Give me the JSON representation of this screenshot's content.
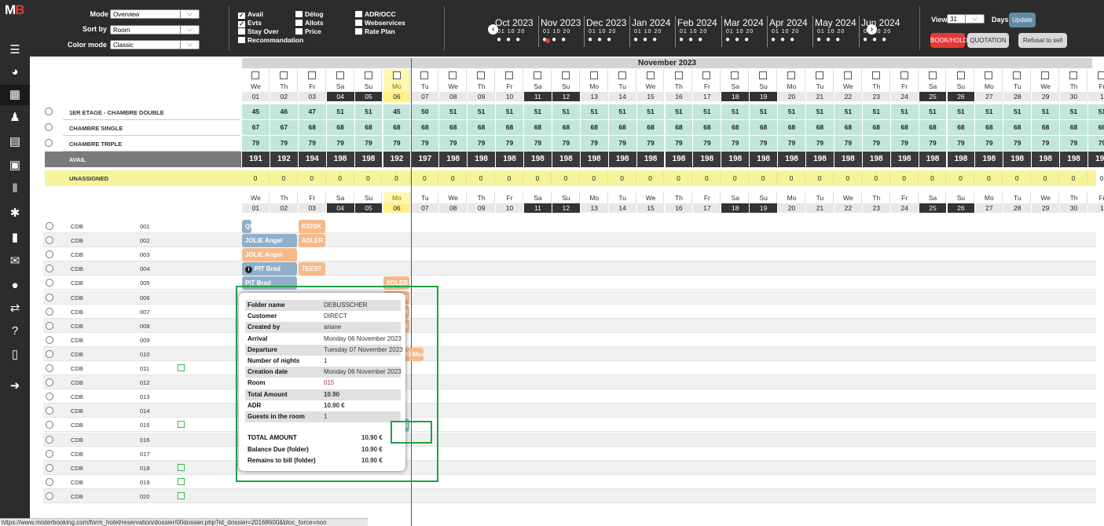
{
  "logo": "MB",
  "sidebar": {
    "icons": [
      "menu-icon",
      "dashboard-icon",
      "calendar-icon",
      "bell-icon",
      "document-icon",
      "calculator-icon",
      "chart-icon",
      "gear-icon",
      "briefcase-icon",
      "mail-icon",
      "user-icon",
      "transfer-icon",
      "help-icon",
      "mobile-icon",
      "logout-icon"
    ]
  },
  "topbar": {
    "mode_label": "Mode",
    "mode_value": "Overview",
    "sort_label": "Sort by",
    "sort_value": "Room",
    "color_label": "Color mode",
    "color_value": "Classic",
    "checks": [
      {
        "label": "Avail",
        "checked": true
      },
      {
        "label": "Evts",
        "checked": true
      },
      {
        "label": "Stay Over",
        "checked": false
      },
      {
        "label": "Recommandation",
        "checked": false
      },
      {
        "label": "Délog",
        "checked": false
      },
      {
        "label": "Allots",
        "checked": false
      },
      {
        "label": "Price",
        "checked": false
      },
      {
        "label": "ADR/OCC",
        "checked": false
      },
      {
        "label": "Webservices",
        "checked": false
      },
      {
        "label": "Rate Plan",
        "checked": false
      }
    ],
    "months": [
      "Oct 2023",
      "Nov 2023",
      "Dec 2023",
      "Jan 2024",
      "Feb 2024",
      "Mar 2024",
      "Apr 2024",
      "May 2024",
      "Jun 2024"
    ],
    "month_days": "01 10 20",
    "view_label": "View",
    "view_value": "31",
    "days_label": "Days",
    "update_label": "Update",
    "book_label": "BOOK/HOLD",
    "quotation_label": "QUOTATION",
    "refusal_label": "Refusal to sell"
  },
  "month_title": "November 2023",
  "days": {
    "dow": [
      "We",
      "Th",
      "Fr",
      "Sa",
      "Su",
      "Mo",
      "Tu",
      "We",
      "Th",
      "Fr",
      "Sa",
      "Su",
      "Mo",
      "Tu",
      "We",
      "Th",
      "Fr",
      "Sa",
      "Su",
      "Mo",
      "Tu",
      "We",
      "Th",
      "Fr",
      "Sa",
      "Su",
      "Mo",
      "Tu",
      "We",
      "Th",
      "Fr"
    ],
    "num": [
      "01",
      "02",
      "03",
      "04",
      "05",
      "06",
      "07",
      "08",
      "09",
      "10",
      "11",
      "12",
      "13",
      "14",
      "15",
      "16",
      "17",
      "18",
      "19",
      "20",
      "21",
      "22",
      "23",
      "24",
      "25",
      "26",
      "27",
      "28",
      "29",
      "30",
      "1"
    ]
  },
  "room_types": [
    {
      "name": "1ER ETAGE - CHAMBRE DOUBLE",
      "values": [
        "45",
        "46",
        "47",
        "51",
        "51",
        "45",
        "50",
        "51",
        "51",
        "51",
        "51",
        "51",
        "51",
        "51",
        "51",
        "51",
        "51",
        "51",
        "51",
        "51",
        "51",
        "51",
        "51",
        "51",
        "51",
        "51",
        "51",
        "51",
        "51",
        "51",
        "51"
      ]
    },
    {
      "name": "CHAMBRE SINGLE",
      "values": [
        "67",
        "67",
        "68",
        "68",
        "68",
        "68",
        "68",
        "68",
        "68",
        "68",
        "68",
        "68",
        "68",
        "68",
        "68",
        "68",
        "68",
        "68",
        "68",
        "68",
        "68",
        "68",
        "68",
        "68",
        "68",
        "68",
        "68",
        "68",
        "68",
        "68",
        "68"
      ]
    },
    {
      "name": "CHAMBRE TRIPLE",
      "values": [
        "79",
        "79",
        "79",
        "79",
        "79",
        "79",
        "79",
        "79",
        "79",
        "79",
        "79",
        "79",
        "79",
        "79",
        "79",
        "79",
        "79",
        "79",
        "79",
        "79",
        "79",
        "79",
        "79",
        "79",
        "79",
        "79",
        "79",
        "79",
        "79",
        "79",
        "79"
      ]
    }
  ],
  "avail": {
    "label": "AVAIL",
    "values": [
      "191",
      "192",
      "194",
      "198",
      "198",
      "192",
      "197",
      "198",
      "198",
      "198",
      "198",
      "198",
      "198",
      "198",
      "198",
      "198",
      "198",
      "198",
      "198",
      "198",
      "198",
      "198",
      "198",
      "198",
      "198",
      "198",
      "198",
      "198",
      "198",
      "198",
      "198"
    ]
  },
  "unassigned": {
    "label": "UNASSIGNED",
    "values": [
      "0",
      "0",
      "0",
      "0",
      "0",
      "0",
      "0",
      "0",
      "0",
      "0",
      "0",
      "0",
      "0",
      "0",
      "0",
      "0",
      "0",
      "0",
      "0",
      "0",
      "0",
      "0",
      "0",
      "0",
      "0",
      "0",
      "0",
      "0",
      "0",
      "0",
      "0"
    ]
  },
  "rooms": [
    {
      "type": "CDB",
      "num": "001",
      "flag": false
    },
    {
      "type": "CDB",
      "num": "002",
      "flag": false
    },
    {
      "type": "CDB",
      "num": "003",
      "flag": false
    },
    {
      "type": "CDB",
      "num": "004",
      "flag": false
    },
    {
      "type": "CDB",
      "num": "005",
      "flag": false
    },
    {
      "type": "CDB",
      "num": "006",
      "flag": false
    },
    {
      "type": "CDB",
      "num": "007",
      "flag": false
    },
    {
      "type": "CDB",
      "num": "008",
      "flag": false
    },
    {
      "type": "CDB",
      "num": "009",
      "flag": false
    },
    {
      "type": "CDB",
      "num": "010",
      "flag": false
    },
    {
      "type": "CDB",
      "num": "011",
      "flag": true
    },
    {
      "type": "CDB",
      "num": "012",
      "flag": false
    },
    {
      "type": "CDB",
      "num": "013",
      "flag": false
    },
    {
      "type": "CDB",
      "num": "014",
      "flag": false
    },
    {
      "type": "CDB",
      "num": "015",
      "flag": true
    },
    {
      "type": "CDB",
      "num": "016",
      "flag": false
    },
    {
      "type": "CDB",
      "num": "017",
      "flag": false
    },
    {
      "type": "CDB",
      "num": "018",
      "flag": true
    },
    {
      "type": "CDB",
      "num": "019",
      "flag": true
    },
    {
      "type": "CDB",
      "num": "020",
      "flag": true
    }
  ],
  "reservations": [
    {
      "label": "QUI",
      "room": 0,
      "start": 0,
      "span": 0.4,
      "color": "#8fb0c8"
    },
    {
      "label": "KIOSK",
      "room": 0,
      "start": 2,
      "span": 1,
      "color": "#f5b98a"
    },
    {
      "label": "JOLIE Angel",
      "room": 1,
      "start": 0,
      "span": 2,
      "color": "#8fb0c8"
    },
    {
      "label": "ADLER",
      "room": 1,
      "start": 2,
      "span": 1,
      "color": "#f5b98a"
    },
    {
      "label": "JOLIE Angel",
      "room": 2,
      "start": 0,
      "span": 2,
      "color": "#f5b98a"
    },
    {
      "label": "PIT Brad",
      "room": 3,
      "start": 0,
      "span": 2,
      "color": "#8fb0c8",
      "icon": true
    },
    {
      "label": "TEEST",
      "room": 3,
      "start": 2,
      "span": 1,
      "color": "#f5b98a"
    },
    {
      "label": "PIT Brad",
      "room": 4,
      "start": 0,
      "span": 2,
      "color": "#8fb0c8"
    },
    {
      "label": "ADLER",
      "room": 4,
      "start": 5,
      "span": 1,
      "color": "#f5b98a"
    },
    {
      "label": "ADLER",
      "room": 5,
      "start": 5,
      "span": 1,
      "color": "#f5b98a"
    },
    {
      "label": "ADLER",
      "room": 6,
      "start": 5,
      "span": 1,
      "color": "#f5b98a"
    },
    {
      "label": "ADLER",
      "room": 7,
      "start": 5,
      "span": 1,
      "color": "#f5b98a"
    },
    {
      "label": "BRUCKI Mus",
      "room": 9,
      "start": 5,
      "span": 1.5,
      "color": "#f5b98a"
    },
    {
      "label": "DEBUS",
      "room": 14,
      "start": 5,
      "span": 1,
      "color": "#7fc8b8"
    }
  ],
  "popup": {
    "rows": [
      {
        "k": "Folder name",
        "v": "DEBUSSCHER"
      },
      {
        "k": "Customer",
        "v": "DIRECT"
      },
      {
        "k": "Created by",
        "v": "ariane"
      },
      {
        "k": "Arrival",
        "v": "Monday 06 November 2023"
      },
      {
        "k": "Departure",
        "v": "Tuesday 07 November 2023"
      },
      {
        "k": "Number of nights",
        "v": "1"
      },
      {
        "k": "Creation date",
        "v": "Monday 06 November 2023"
      },
      {
        "k": "Room",
        "v": "015"
      },
      {
        "k": "Total Amount",
        "v": "10.90"
      },
      {
        "k": "ADR",
        "v": "10.90 €"
      },
      {
        "k": "Guests in the room",
        "v": "1"
      }
    ],
    "totals": [
      {
        "k": "TOTAL AMOUNT",
        "v": "10.90 €"
      },
      {
        "k": "Balance Due (folder)",
        "v": "10.90 €"
      },
      {
        "k": "Remains to bill (folder)",
        "v": "10.90 €"
      }
    ]
  },
  "status_url": "https://www.misterbooking.com/form_hotel/reservation/dossier/00dossier.php?id_dossier=20168600&bloc_force=non",
  "colors": {
    "sidebar": "#2c2c2c",
    "avail_row": "#7a7a7a",
    "room_values": "#c3e6dc",
    "unassigned": "#f7f39b",
    "weekend": "#333333"
  }
}
